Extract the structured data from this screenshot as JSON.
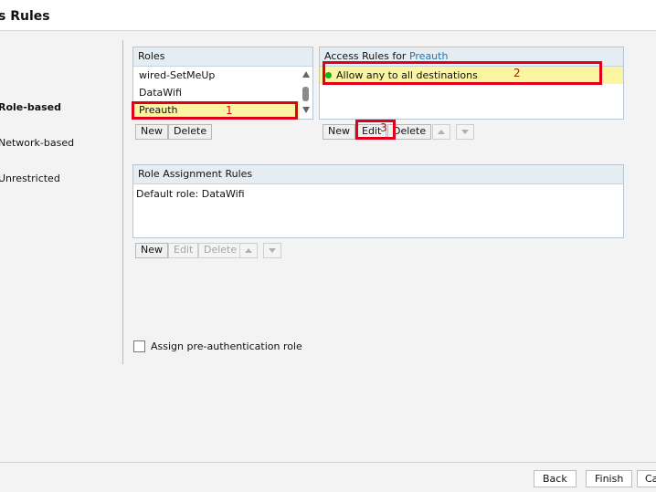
{
  "page": {
    "title": "s Rules"
  },
  "left_options": [
    {
      "label": "Role-based"
    },
    {
      "label": "Network-based"
    },
    {
      "label": "Unrestricted"
    }
  ],
  "roles": {
    "header": "Roles",
    "items": [
      "wired-SetMeUp",
      "DataWifi",
      "Preauth"
    ],
    "buttons": {
      "new": "New",
      "delete": "Delete"
    }
  },
  "access_rules": {
    "header_prefix": "Access Rules for",
    "role": "Preauth",
    "items": [
      "Allow any to all destinations"
    ],
    "buttons": {
      "new": "New",
      "edit": "Edit",
      "delete": "Delete"
    }
  },
  "assignment": {
    "header": "Role Assignment Rules",
    "default_label": "Default role: DataWifi",
    "buttons": {
      "new": "New",
      "edit": "Edit",
      "delete": "Delete"
    }
  },
  "preauth": {
    "label": "Assign pre-authentication role"
  },
  "annotations": [
    "1",
    "2",
    "3"
  ],
  "footer": {
    "back": "Back",
    "finish": "Finish",
    "cancel": "Ca"
  },
  "colors": {
    "highlight": "#fbf5a2",
    "annotation": "#e0001b",
    "accent": "#1f73b7",
    "status_green": "#19b01a"
  }
}
